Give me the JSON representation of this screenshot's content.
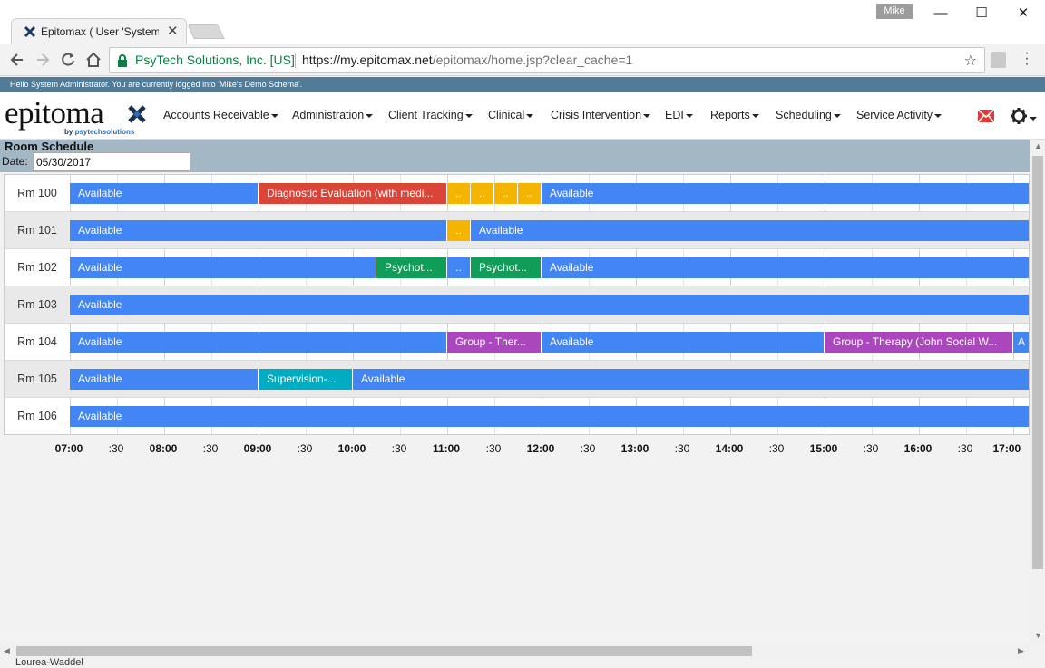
{
  "browser": {
    "tab_title": "Epitomax ( User 'System",
    "profile": "Mike",
    "secure_label": "PsyTech Solutions, Inc. [US]",
    "url_host": "https://my.epitomax.net",
    "url_path": "/epitomax/home.jsp?clear_cache=1"
  },
  "app": {
    "login_message": "Hello System Administrator. You are currently logged into 'Mike's Demo Schema'.",
    "logo_text": "epitoma",
    "logo_sub_prefix": "by ",
    "logo_sub_brand": "psytechsolutions",
    "menu": [
      "Accounts Receivable",
      "Administration",
      "Client Tracking",
      "Clinical",
      "Crisis Intervention",
      "EDI",
      "Reports",
      "Scheduling",
      "Service Activity"
    ]
  },
  "schedule": {
    "title": "Room Schedule",
    "date_label": "Date:",
    "date_value": "05/30/2017",
    "time_ticks": [
      "07:00",
      ":30",
      "08:00",
      ":30",
      "09:00",
      ":30",
      "10:00",
      ":30",
      "11:00",
      ":30",
      "12:00",
      ":30",
      "13:00",
      ":30",
      "14:00",
      ":30",
      "15:00",
      ":30",
      "16:00",
      ":30",
      "17:00"
    ],
    "colors": {
      "available": "#4285f4",
      "diagnostic": "#db4437",
      "short": "#f4b400",
      "psychotherapy": "#0f9d58",
      "group": "#ab47bc",
      "supervision": "#00acc1"
    },
    "rooms": [
      {
        "name": "Rm 100",
        "blocks": [
          {
            "label": "Available",
            "kind": "available",
            "start": 7.0,
            "end": 9.0
          },
          {
            "label": "Diagnostic Evaluation (with medi...",
            "kind": "diagnostic",
            "start": 9.0,
            "end": 11.0
          },
          {
            "label": "..",
            "kind": "short",
            "start": 11.0,
            "end": 11.25
          },
          {
            "label": "..",
            "kind": "short",
            "start": 11.25,
            "end": 11.5
          },
          {
            "label": "..",
            "kind": "short",
            "start": 11.5,
            "end": 11.75
          },
          {
            "label": "..",
            "kind": "short",
            "start": 11.75,
            "end": 12.0
          },
          {
            "label": "Available",
            "kind": "available",
            "start": 12.0,
            "end": 17.3
          }
        ]
      },
      {
        "name": "Rm 101",
        "blocks": [
          {
            "label": "Available",
            "kind": "available",
            "start": 7.0,
            "end": 11.0
          },
          {
            "label": "..",
            "kind": "short",
            "start": 11.0,
            "end": 11.25
          },
          {
            "label": "Available",
            "kind": "available",
            "start": 11.25,
            "end": 17.3
          }
        ]
      },
      {
        "name": "Rm 102",
        "blocks": [
          {
            "label": "Available",
            "kind": "available",
            "start": 7.0,
            "end": 10.25
          },
          {
            "label": "Psychot...",
            "kind": "psychotherapy",
            "start": 10.25,
            "end": 11.0
          },
          {
            "label": "..",
            "kind": "available",
            "start": 11.0,
            "end": 11.25
          },
          {
            "label": "Psychot...",
            "kind": "psychotherapy",
            "start": 11.25,
            "end": 12.0
          },
          {
            "label": "Available",
            "kind": "available",
            "start": 12.0,
            "end": 17.3
          }
        ]
      },
      {
        "name": "Rm 103",
        "blocks": [
          {
            "label": "Available",
            "kind": "available",
            "start": 7.0,
            "end": 17.3
          }
        ]
      },
      {
        "name": "Rm 104",
        "blocks": [
          {
            "label": "Available",
            "kind": "available",
            "start": 7.0,
            "end": 11.0
          },
          {
            "label": "Group - Ther...",
            "kind": "group",
            "start": 11.0,
            "end": 12.0
          },
          {
            "label": "Available",
            "kind": "available",
            "start": 12.0,
            "end": 15.0
          },
          {
            "label": "Group - Therapy (John Social W...",
            "kind": "group",
            "start": 15.0,
            "end": 17.0
          },
          {
            "label": "A",
            "kind": "available",
            "start": 17.0,
            "end": 17.3
          }
        ]
      },
      {
        "name": "Rm 105",
        "blocks": [
          {
            "label": "Available",
            "kind": "available",
            "start": 7.0,
            "end": 9.0
          },
          {
            "label": "Supervision-...",
            "kind": "supervision",
            "start": 9.0,
            "end": 10.0
          },
          {
            "label": "Available",
            "kind": "available",
            "start": 10.0,
            "end": 17.3
          }
        ]
      },
      {
        "name": "Rm 106",
        "blocks": [
          {
            "label": "Available",
            "kind": "available",
            "start": 7.0,
            "end": 17.3
          }
        ]
      }
    ]
  },
  "footer_text": "Lourea-Waddel"
}
